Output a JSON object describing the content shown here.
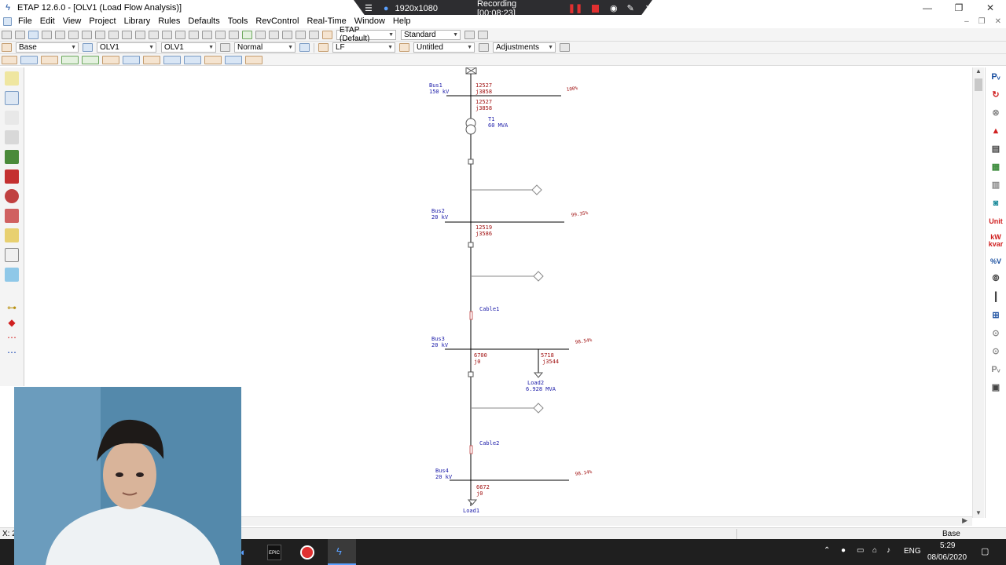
{
  "window": {
    "title": "ETAP 12.6.0 - [OLV1 (Load Flow Analysis)]",
    "controls": {
      "minimize": "—",
      "restore": "❐",
      "close": "✕"
    }
  },
  "recorder": {
    "resolution": "1920x1080",
    "status": "Recording [00:08:23]"
  },
  "menu": {
    "items": [
      "File",
      "Edit",
      "View",
      "Project",
      "Library",
      "Rules",
      "Defaults",
      "Tools",
      "RevControl",
      "Real-Time",
      "Window",
      "Help"
    ],
    "mdi_controls": {
      "minimize": "–",
      "restore": "❐",
      "close": "✕"
    }
  },
  "toolbar1": {
    "config_combo": "ETAP (Default)",
    "standard_combo": "Standard"
  },
  "toolbar2": {
    "base_combo": "Base",
    "olv_combo": "OLV1",
    "olv2_combo": "OLV1",
    "mode_combo": "Normal",
    "study_combo": "LF",
    "untitled_combo": "Untitled",
    "adjustments_combo": "Adjustments"
  },
  "right_panel": {
    "unit_label": "Unit",
    "kw_label": "kW",
    "kvar_label": "kvar",
    "pct_v_label": "%V"
  },
  "diagram": {
    "bus1": {
      "name": "Bus1",
      "kv": "150 kV",
      "pct": "100%",
      "flow_p": "12527",
      "flow_q": "j3858",
      "flow2_p": "12527",
      "flow2_q": "j3858"
    },
    "t1": {
      "name": "T1",
      "rating": "60 MVA"
    },
    "bus2": {
      "name": "Bus2",
      "kv": "20 kV",
      "pct": "99.35%",
      "flow_p": "12519",
      "flow_q": "j3586"
    },
    "cable1": {
      "name": "Cable1"
    },
    "bus3": {
      "name": "Bus3",
      "kv": "20 kV",
      "pct": "98.54%",
      "flow_p": "6700",
      "flow_q": "j0",
      "flow2_p": "5718",
      "flow2_q": "j3544"
    },
    "load2": {
      "name": "Load2",
      "rating": "6.928 MVA"
    },
    "cable2": {
      "name": "Cable2"
    },
    "bus4": {
      "name": "Bus4",
      "kv": "20 kV",
      "pct": "98.14%",
      "flow_p": "6672",
      "flow_q": "j0"
    },
    "load1": {
      "name": "Load1"
    }
  },
  "status": {
    "coords": "X: 2",
    "base": "Base"
  },
  "taskbar": {
    "lang": "ENG",
    "time": "5:29",
    "date": "08/06/2020",
    "epic_label": "EPIC"
  },
  "colors": {
    "diagram_blue": "#1a1aa8",
    "diagram_red": "#a01010",
    "recording_red": "#e03030"
  }
}
